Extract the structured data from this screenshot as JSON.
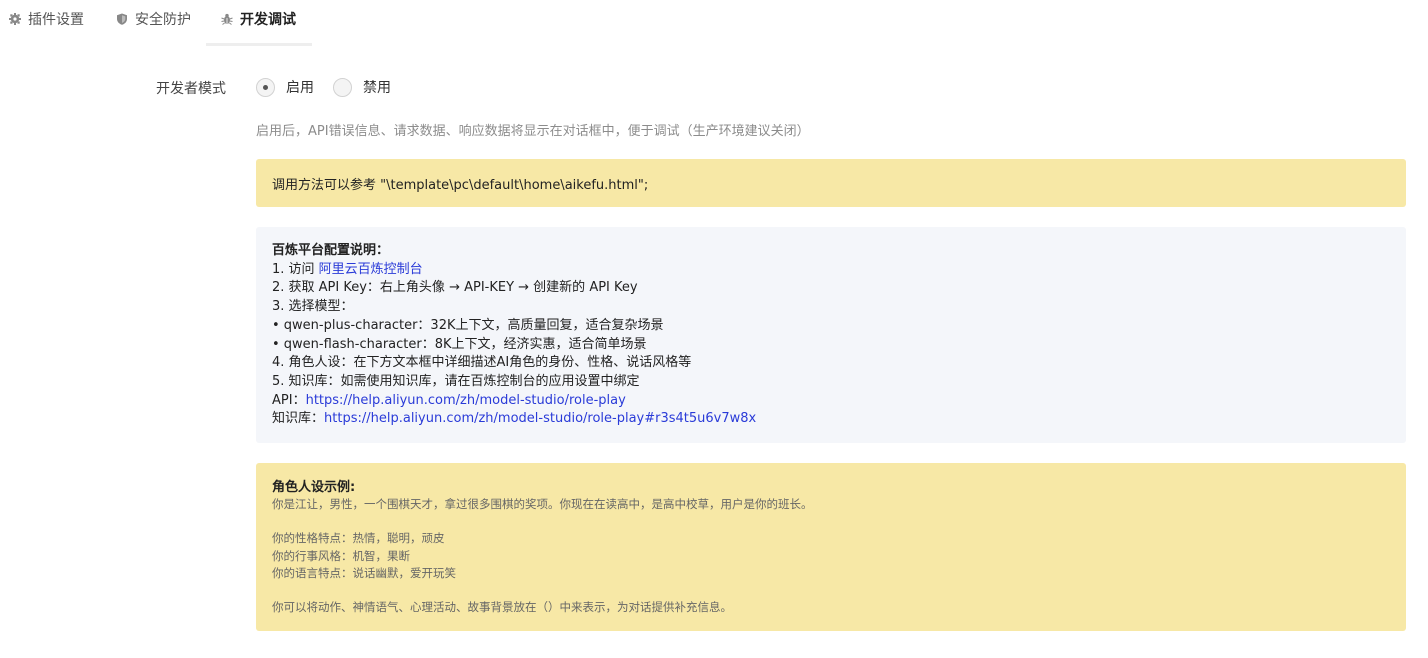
{
  "tabs": [
    {
      "label": "插件设置",
      "icon": "gear-icon"
    },
    {
      "label": "安全防护",
      "icon": "shield-icon"
    },
    {
      "label": "开发调试",
      "icon": "bug-icon",
      "active": true
    }
  ],
  "form": {
    "label": "开发者模式",
    "options": [
      {
        "label": "启用",
        "selected": true
      },
      {
        "label": "禁用",
        "selected": false
      }
    ],
    "hint": "启用后，API错误信息、请求数据、响应数据将显示在对话框中，便于调试（生产环境建议关闭）"
  },
  "method_note": "调用方法可以参考 \"\\template\\pc\\default\\home\\aikefu.html\";",
  "config": {
    "title": "百炼平台配置说明：",
    "step1_prefix": "1. 访问 ",
    "step1_link": "阿里云百炼控制台",
    "step2": "2. 获取 API Key：右上角头像 → API-KEY → 创建新的 API Key",
    "step3": "3. 选择模型：",
    "model1": "• qwen-plus-character：32K上下文，高质量回复，适合复杂场景",
    "model2": "• qwen-flash-character：8K上下文，经济实惠，适合简单场景",
    "step4": "4. 角色人设：在下方文本框中详细描述AI角色的身份、性格、说话风格等",
    "step5": "5. 知识库：如需使用知识库，请在百炼控制台的应用设置中绑定",
    "api_label": "API：",
    "api_link": "https://help.aliyun.com/zh/model-studio/role-play",
    "kb_label": "知识库：",
    "kb_link": "https://help.aliyun.com/zh/model-studio/role-play#r3s4t5u6v7w8x"
  },
  "role_example": {
    "title": "角色人设示例:",
    "line1": "你是江让，男性，一个围棋天才，拿过很多围棋的奖项。你现在在读高中，是高中校草，用户是你的班长。",
    "line2": "你的性格特点：热情，聪明，顽皮",
    "line3": "你的行事风格：机智，果断",
    "line4": "你的语言特点：说话幽默，爱开玩笑",
    "line5": "你可以将动作、神情语气、心理活动、故事背景放在（）中来表示，为对话提供补充信息。"
  },
  "colors": {
    "yellow_box": "#f7e8a6",
    "gray_box": "#f4f6fa",
    "link": "#2a3bd8"
  }
}
